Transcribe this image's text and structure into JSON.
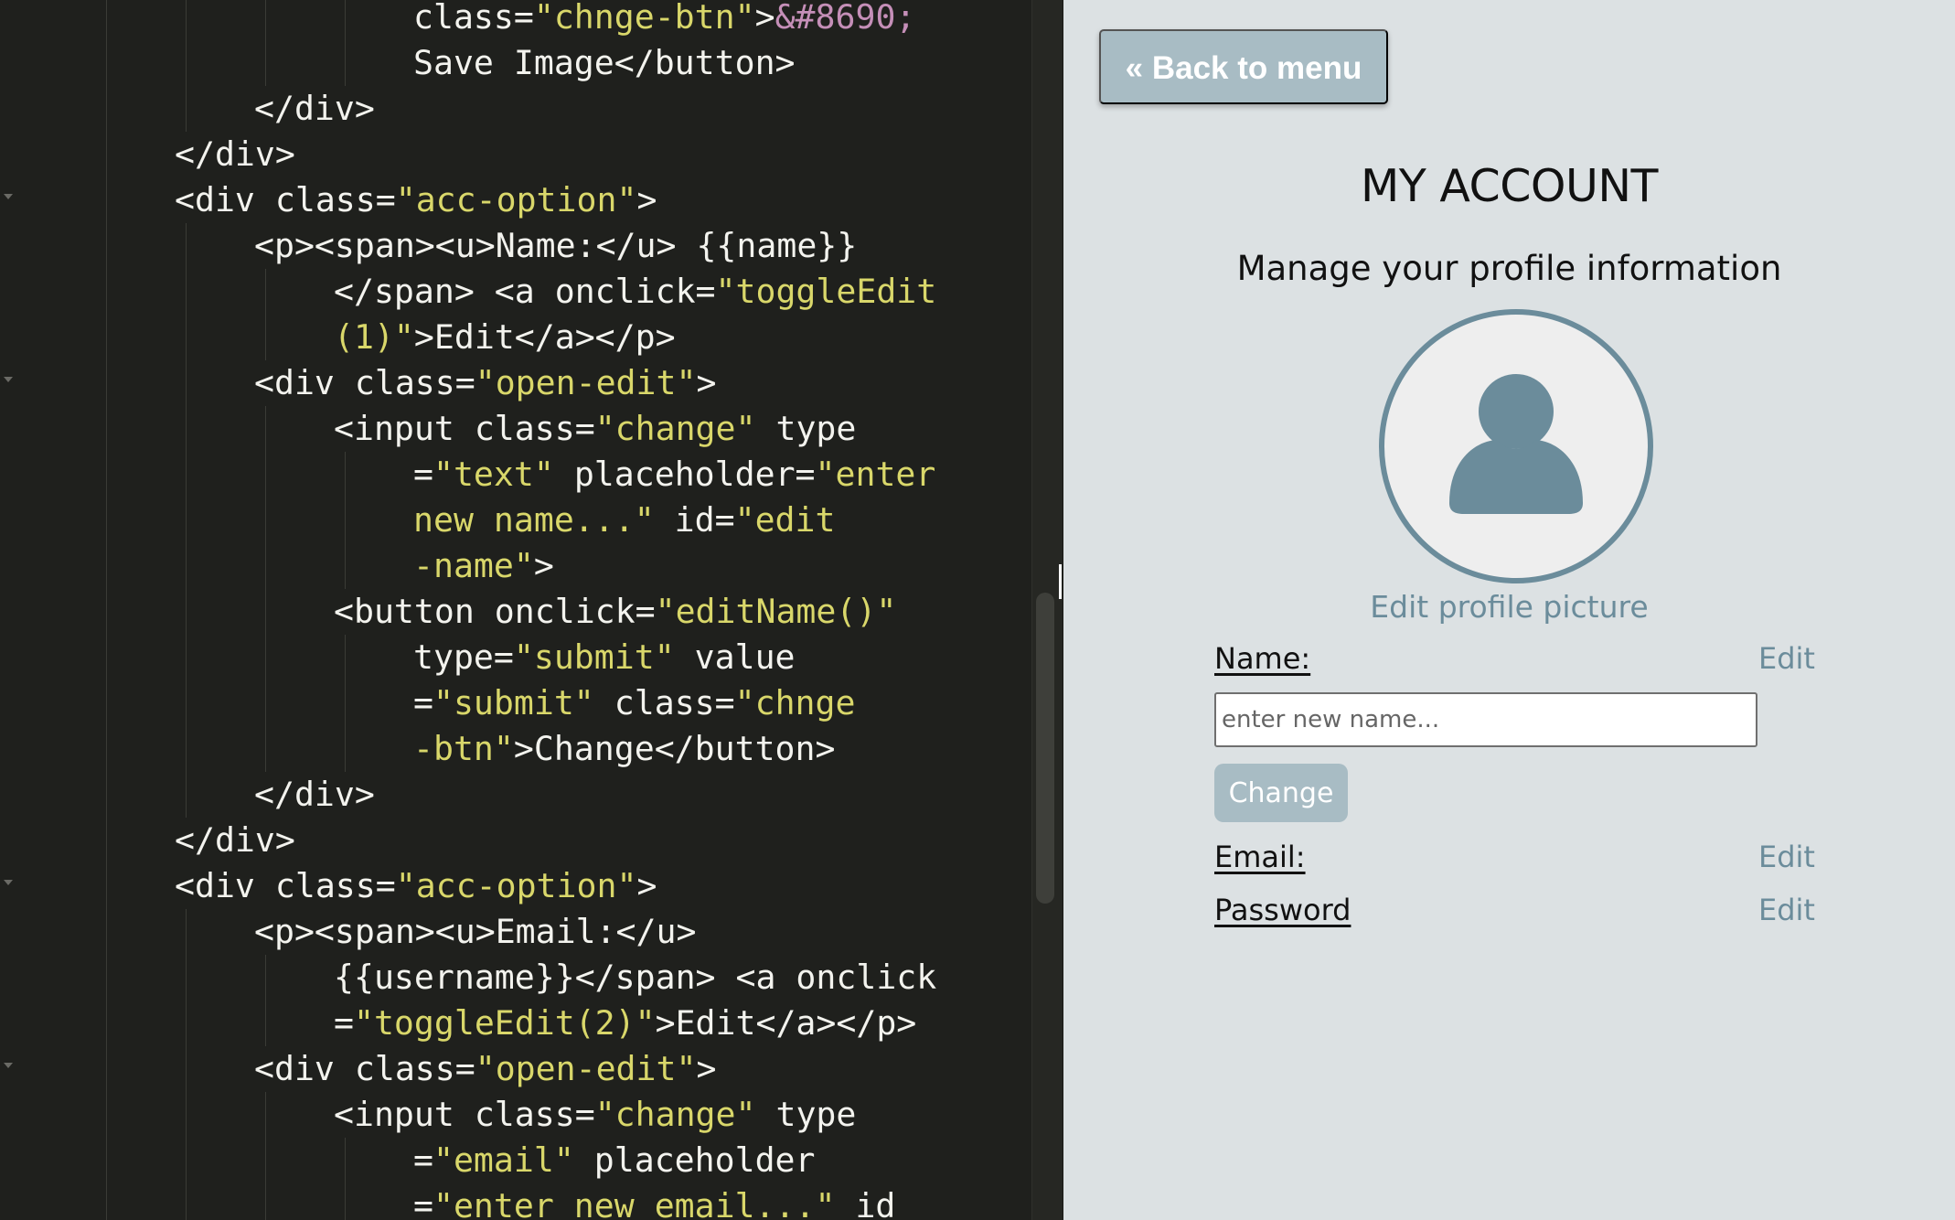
{
  "editor": {
    "lines": [
      {
        "fold": false,
        "guides": [
          1,
          2,
          3,
          4,
          5
        ],
        "segments": [
          {
            "t": "class=",
            "c": ""
          },
          {
            "t": "\"chnge-btn\"",
            "c": "str"
          },
          {
            "t": ">",
            "c": ""
          },
          {
            "t": "&#8690;",
            "c": "ent"
          }
        ]
      },
      {
        "fold": false,
        "guides": [
          1,
          2,
          3,
          4,
          5
        ],
        "segments": [
          {
            "t": "Save Image</button>",
            "c": ""
          }
        ]
      },
      {
        "fold": false,
        "guides": [
          1,
          2,
          3
        ],
        "segments": [
          {
            "t": "</div>",
            "c": ""
          }
        ]
      },
      {
        "fold": false,
        "guides": [
          1,
          2
        ],
        "segments": [
          {
            "t": "</div>",
            "c": ""
          }
        ]
      },
      {
        "fold": true,
        "guides": [
          1,
          2
        ],
        "segments": [
          {
            "t": "<div class=",
            "c": ""
          },
          {
            "t": "\"acc-option\"",
            "c": "str"
          },
          {
            "t": ">",
            "c": ""
          }
        ]
      },
      {
        "fold": false,
        "guides": [
          1,
          2,
          3
        ],
        "segments": [
          {
            "t": "<p><span><u>Name:</u> {{name}}",
            "c": ""
          }
        ]
      },
      {
        "fold": false,
        "guides": [
          1,
          2,
          3,
          4
        ],
        "segments": [
          {
            "t": "</span> <a onclick=",
            "c": ""
          },
          {
            "t": "\"toggleEdit",
            "c": "str"
          }
        ]
      },
      {
        "fold": false,
        "guides": [
          1,
          2,
          3,
          4
        ],
        "segments": [
          {
            "t": "(1)\"",
            "c": "str"
          },
          {
            "t": ">Edit</a></p>",
            "c": ""
          }
        ]
      },
      {
        "fold": true,
        "guides": [
          1,
          2,
          3
        ],
        "segments": [
          {
            "t": "<div class=",
            "c": ""
          },
          {
            "t": "\"open-edit\"",
            "c": "str"
          },
          {
            "t": ">",
            "c": ""
          }
        ]
      },
      {
        "fold": false,
        "guides": [
          1,
          2,
          3,
          4
        ],
        "segments": [
          {
            "t": "<input class=",
            "c": ""
          },
          {
            "t": "\"change\"",
            "c": "str"
          },
          {
            "t": " type",
            "c": ""
          }
        ]
      },
      {
        "fold": false,
        "guides": [
          1,
          2,
          3,
          4,
          5
        ],
        "segments": [
          {
            "t": "=",
            "c": ""
          },
          {
            "t": "\"text\"",
            "c": "str"
          },
          {
            "t": " placeholder=",
            "c": ""
          },
          {
            "t": "\"enter",
            "c": "str"
          }
        ]
      },
      {
        "fold": false,
        "guides": [
          1,
          2,
          3,
          4,
          5
        ],
        "segments": [
          {
            "t": "new name...\"",
            "c": "str"
          },
          {
            "t": " id=",
            "c": ""
          },
          {
            "t": "\"edit",
            "c": "str"
          }
        ]
      },
      {
        "fold": false,
        "guides": [
          1,
          2,
          3,
          4,
          5
        ],
        "segments": [
          {
            "t": "-name\"",
            "c": "str"
          },
          {
            "t": ">",
            "c": ""
          }
        ]
      },
      {
        "fold": false,
        "guides": [
          1,
          2,
          3,
          4
        ],
        "segments": [
          {
            "t": "<button onclick=",
            "c": ""
          },
          {
            "t": "\"editName()\"",
            "c": "str"
          }
        ]
      },
      {
        "fold": false,
        "guides": [
          1,
          2,
          3,
          4,
          5
        ],
        "segments": [
          {
            "t": "type=",
            "c": ""
          },
          {
            "t": "\"submit\"",
            "c": "str"
          },
          {
            "t": " value",
            "c": ""
          }
        ]
      },
      {
        "fold": false,
        "guides": [
          1,
          2,
          3,
          4,
          5
        ],
        "segments": [
          {
            "t": "=",
            "c": ""
          },
          {
            "t": "\"submit\"",
            "c": "str"
          },
          {
            "t": " class=",
            "c": ""
          },
          {
            "t": "\"chnge",
            "c": "str"
          }
        ]
      },
      {
        "fold": false,
        "guides": [
          1,
          2,
          3,
          4,
          5
        ],
        "segments": [
          {
            "t": "-btn\"",
            "c": "str"
          },
          {
            "t": ">Change</button>",
            "c": ""
          }
        ]
      },
      {
        "fold": false,
        "guides": [
          1,
          2,
          3
        ],
        "segments": [
          {
            "t": "</div>",
            "c": ""
          }
        ]
      },
      {
        "fold": false,
        "guides": [
          1,
          2
        ],
        "segments": [
          {
            "t": "</div>",
            "c": ""
          }
        ]
      },
      {
        "fold": true,
        "guides": [
          1,
          2
        ],
        "segments": [
          {
            "t": "<div class=",
            "c": ""
          },
          {
            "t": "\"acc-option\"",
            "c": "str"
          },
          {
            "t": ">",
            "c": ""
          }
        ]
      },
      {
        "fold": false,
        "guides": [
          1,
          2,
          3
        ],
        "segments": [
          {
            "t": "<p><span><u>Email:</u>",
            "c": ""
          }
        ]
      },
      {
        "fold": false,
        "guides": [
          1,
          2,
          3,
          4
        ],
        "segments": [
          {
            "t": "{{username}}</span> <a onclick",
            "c": ""
          }
        ]
      },
      {
        "fold": false,
        "guides": [
          1,
          2,
          3,
          4
        ],
        "segments": [
          {
            "t": "=",
            "c": ""
          },
          {
            "t": "\"toggleEdit(2)\"",
            "c": "str"
          },
          {
            "t": ">Edit</a></p>",
            "c": ""
          }
        ]
      },
      {
        "fold": true,
        "guides": [
          1,
          2,
          3
        ],
        "segments": [
          {
            "t": "<div class=",
            "c": ""
          },
          {
            "t": "\"open-edit\"",
            "c": "str"
          },
          {
            "t": ">",
            "c": ""
          }
        ]
      },
      {
        "fold": false,
        "guides": [
          1,
          2,
          3,
          4
        ],
        "segments": [
          {
            "t": "<input class=",
            "c": ""
          },
          {
            "t": "\"change\"",
            "c": "str"
          },
          {
            "t": " type",
            "c": ""
          }
        ]
      },
      {
        "fold": false,
        "guides": [
          1,
          2,
          3,
          4,
          5
        ],
        "segments": [
          {
            "t": "=",
            "c": ""
          },
          {
            "t": "\"email\"",
            "c": "str"
          },
          {
            "t": " placeholder",
            "c": ""
          }
        ]
      },
      {
        "fold": false,
        "guides": [
          1,
          2,
          3,
          4,
          5
        ],
        "segments": [
          {
            "t": "=",
            "c": ""
          },
          {
            "t": "\"enter new email...\"",
            "c": "str"
          },
          {
            "t": " id",
            "c": ""
          }
        ]
      }
    ],
    "indents": [
      5,
      5,
      3,
      2,
      2,
      3,
      4,
      4,
      3,
      4,
      5,
      5,
      5,
      4,
      5,
      5,
      5,
      3,
      2,
      2,
      3,
      4,
      4,
      3,
      4,
      5,
      5
    ]
  },
  "preview": {
    "back_label": "« Back to menu",
    "title": "MY ACCOUNT",
    "subtitle": "Manage your profile information",
    "avatar_icon": "user-silhouette-icon",
    "edit_picture_label": "Edit profile picture",
    "fields": {
      "name_label": "Name:",
      "email_label": "Email:",
      "password_label": "Password"
    },
    "edit_label": "Edit",
    "name_input_placeholder": "enter new name...",
    "change_label": "Change"
  },
  "colors": {
    "editor_bg": "#1f201d",
    "code_text": "#f3f3ee",
    "code_string": "#d9d76a",
    "code_entity": "#c58fb8",
    "preview_bg": "#dce1e3",
    "accent": "#6b8c9b",
    "button_bg": "#a8bcc4"
  }
}
